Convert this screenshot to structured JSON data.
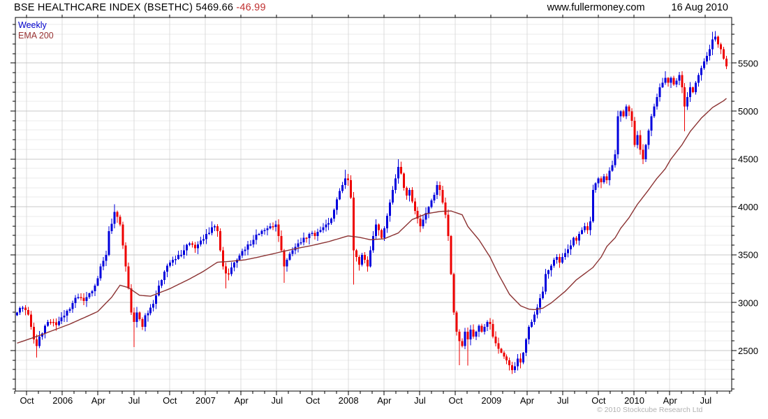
{
  "header": {
    "title_main": "BSE HEALTHCARE INDEX (BSETHC) 5469.66",
    "change": "-46.99",
    "site": "www.fullermoney.com",
    "date": "16 Aug 2010"
  },
  "legend": {
    "series1": "Weekly",
    "series2": "EMA 200"
  },
  "footer": {
    "copyright": "© 2010 Stockcube Research Ltd"
  },
  "colors": {
    "up_candle": "#0000dd",
    "down_candle": "#ee0000",
    "ema_line": "#8b3232",
    "grid_major": "#c8c8c8",
    "grid_minor": "#ebebeb",
    "grid_vertical": "#dcdcdc",
    "axis": "#000000",
    "label": "#000000"
  },
  "chart_data": {
    "type": "candlestick",
    "title": "BSE HEALTHCARE INDEX (BSETHC)",
    "last_close": 5469.66,
    "change": -46.99,
    "timeframe": "Weekly",
    "overlay": "EMA 200",
    "n_weeks": 256,
    "period_start": "Sep 2005",
    "period_end": "16 Aug 2010",
    "y_axis": {
      "range": [
        2080,
        5980
      ],
      "tick_minor": 100,
      "tick_major": 500,
      "labels": [
        2500,
        3000,
        3500,
        4000,
        4500,
        5000,
        5500
      ],
      "side": "right"
    },
    "x_axis": {
      "months_total": 60,
      "quarter_label_months": [
        1,
        4,
        7,
        10,
        13,
        16,
        19,
        22,
        25,
        28,
        31,
        34,
        37,
        40,
        43,
        46,
        49,
        52,
        55,
        58
      ],
      "labels": [
        "Oct",
        "2006",
        "Apr",
        "Jul",
        "Oct",
        "2007",
        "Apr",
        "Jul",
        "Oct",
        "2008",
        "Apr",
        "Jul",
        "Oct",
        "2009",
        "Apr",
        "Jul",
        "Oct",
        "2010",
        "Apr",
        "Jul"
      ]
    },
    "candles": {
      "first_open": 2870,
      "wiggle": [
        0,
        22,
        -18,
        12,
        -24
      ],
      "close_anchors": [
        [
          0,
          2900
        ],
        [
          2,
          2950
        ],
        [
          4,
          2880
        ],
        [
          6,
          2620
        ],
        [
          7,
          2550
        ],
        [
          8,
          2650
        ],
        [
          10,
          2760
        ],
        [
          12,
          2800
        ],
        [
          14,
          2770
        ],
        [
          16,
          2850
        ],
        [
          18,
          2920
        ],
        [
          20,
          3000
        ],
        [
          22,
          3060
        ],
        [
          24,
          3020
        ],
        [
          26,
          3100
        ],
        [
          28,
          3180
        ],
        [
          30,
          3380
        ],
        [
          31,
          3440
        ],
        [
          32,
          3500
        ],
        [
          33,
          3750
        ],
        [
          35,
          3950
        ],
        [
          36,
          3900
        ],
        [
          37,
          3820
        ],
        [
          38,
          3600
        ],
        [
          39,
          3380
        ],
        [
          40,
          3150
        ],
        [
          41,
          2900
        ],
        [
          42,
          2800
        ],
        [
          43,
          2900
        ],
        [
          44,
          2830
        ],
        [
          45,
          2750
        ],
        [
          46,
          2870
        ],
        [
          48,
          2950
        ],
        [
          50,
          3080
        ],
        [
          52,
          3240
        ],
        [
          54,
          3390
        ],
        [
          56,
          3450
        ],
        [
          58,
          3500
        ],
        [
          60,
          3550
        ],
        [
          62,
          3620
        ],
        [
          64,
          3570
        ],
        [
          66,
          3650
        ],
        [
          68,
          3720
        ],
        [
          70,
          3790
        ],
        [
          71,
          3800
        ],
        [
          72,
          3750
        ],
        [
          73,
          3550
        ],
        [
          74,
          3380
        ],
        [
          75,
          3310
        ],
        [
          76,
          3300
        ],
        [
          77,
          3370
        ],
        [
          79,
          3450
        ],
        [
          81,
          3540
        ],
        [
          83,
          3610
        ],
        [
          85,
          3660
        ],
        [
          87,
          3720
        ],
        [
          89,
          3760
        ],
        [
          91,
          3800
        ],
        [
          93,
          3820
        ],
        [
          94,
          3700
        ],
        [
          95,
          3550
        ],
        [
          96,
          3380
        ],
        [
          97,
          3450
        ],
        [
          99,
          3550
        ],
        [
          101,
          3620
        ],
        [
          103,
          3680
        ],
        [
          105,
          3720
        ],
        [
          107,
          3700
        ],
        [
          109,
          3760
        ],
        [
          111,
          3820
        ],
        [
          113,
          3880
        ],
        [
          114,
          3970
        ],
        [
          115,
          4080
        ],
        [
          116,
          4170
        ],
        [
          117,
          4230
        ],
        [
          118,
          4300
        ],
        [
          119,
          4280
        ],
        [
          120,
          4100
        ],
        [
          121,
          3550
        ],
        [
          122,
          3480
        ],
        [
          123,
          3400
        ],
        [
          124,
          3500
        ],
        [
          125,
          3450
        ],
        [
          126,
          3380
        ],
        [
          127,
          3550
        ],
        [
          128,
          3700
        ],
        [
          129,
          3820
        ],
        [
          130,
          3760
        ],
        [
          131,
          3680
        ],
        [
          132,
          3780
        ],
        [
          133,
          3910
        ],
        [
          134,
          4050
        ],
        [
          135,
          4180
        ],
        [
          136,
          4300
        ],
        [
          137,
          4420
        ],
        [
          138,
          4350
        ],
        [
          139,
          4200
        ],
        [
          140,
          4120
        ],
        [
          141,
          4180
        ],
        [
          142,
          4060
        ],
        [
          143,
          3960
        ],
        [
          144,
          3880
        ],
        [
          145,
          3800
        ],
        [
          146,
          3870
        ],
        [
          147,
          3940
        ],
        [
          148,
          4000
        ],
        [
          149,
          4070
        ],
        [
          150,
          4130
        ],
        [
          151,
          4230
        ],
        [
          152,
          4180
        ],
        [
          153,
          4050
        ],
        [
          154,
          3920
        ],
        [
          155,
          3700
        ],
        [
          156,
          3300
        ],
        [
          157,
          2900
        ],
        [
          158,
          2700
        ],
        [
          159,
          2600
        ],
        [
          160,
          2550
        ],
        [
          161,
          2700
        ],
        [
          162,
          2620
        ],
        [
          163,
          2720
        ],
        [
          164,
          2650
        ],
        [
          165,
          2700
        ],
        [
          166,
          2760
        ],
        [
          167,
          2700
        ],
        [
          168,
          2750
        ],
        [
          169,
          2800
        ],
        [
          170,
          2780
        ],
        [
          171,
          2650
        ],
        [
          172,
          2580
        ],
        [
          173,
          2520
        ],
        [
          174,
          2480
        ],
        [
          175,
          2440
        ],
        [
          176,
          2400
        ],
        [
          177,
          2350
        ],
        [
          178,
          2300
        ],
        [
          179,
          2340
        ],
        [
          180,
          2420
        ],
        [
          181,
          2380
        ],
        [
          182,
          2480
        ],
        [
          183,
          2620
        ],
        [
          184,
          2750
        ],
        [
          185,
          2800
        ],
        [
          186,
          2880
        ],
        [
          187,
          2950
        ],
        [
          188,
          3050
        ],
        [
          189,
          3120
        ],
        [
          190,
          3300
        ],
        [
          191,
          3340
        ],
        [
          192,
          3390
        ],
        [
          193,
          3450
        ],
        [
          194,
          3480
        ],
        [
          195,
          3420
        ],
        [
          196,
          3480
        ],
        [
          197,
          3520
        ],
        [
          198,
          3560
        ],
        [
          199,
          3600
        ],
        [
          200,
          3680
        ],
        [
          201,
          3650
        ],
        [
          202,
          3720
        ],
        [
          203,
          3760
        ],
        [
          204,
          3800
        ],
        [
          205,
          3760
        ],
        [
          206,
          3850
        ],
        [
          207,
          4180
        ],
        [
          208,
          4250
        ],
        [
          209,
          4300
        ],
        [
          210,
          4260
        ],
        [
          211,
          4320
        ],
        [
          212,
          4280
        ],
        [
          213,
          4380
        ],
        [
          214,
          4440
        ],
        [
          215,
          4550
        ],
        [
          216,
          4950
        ],
        [
          217,
          5000
        ],
        [
          218,
          4950
        ],
        [
          219,
          5050
        ],
        [
          220,
          5000
        ],
        [
          221,
          4900
        ],
        [
          222,
          4650
        ],
        [
          223,
          4750
        ],
        [
          224,
          4600
        ],
        [
          225,
          4500
        ],
        [
          226,
          4650
        ],
        [
          227,
          4800
        ],
        [
          228,
          4950
        ],
        [
          229,
          5050
        ],
        [
          230,
          5150
        ],
        [
          231,
          5250
        ],
        [
          232,
          5300
        ],
        [
          233,
          5350
        ],
        [
          234,
          5300
        ],
        [
          235,
          5350
        ],
        [
          236,
          5280
        ],
        [
          237,
          5320
        ],
        [
          238,
          5380
        ],
        [
          239,
          5250
        ],
        [
          240,
          5050
        ],
        [
          241,
          5150
        ],
        [
          242,
          5250
        ],
        [
          243,
          5200
        ],
        [
          244,
          5300
        ],
        [
          245,
          5380
        ],
        [
          246,
          5450
        ],
        [
          247,
          5520
        ],
        [
          248,
          5580
        ],
        [
          249,
          5650
        ],
        [
          250,
          5750
        ],
        [
          251,
          5780
        ],
        [
          252,
          5700
        ],
        [
          253,
          5650
        ],
        [
          254,
          5550
        ],
        [
          255,
          5469.66
        ]
      ],
      "wick_overrides": {
        "7": {
          "low": 2430
        },
        "35": {
          "high": 4030
        },
        "42": {
          "low": 2540
        },
        "70": {
          "high": 3850
        },
        "75": {
          "low": 3150
        },
        "93": {
          "high": 3860
        },
        "96": {
          "low": 3210
        },
        "118": {
          "high": 4390
        },
        "121": {
          "low": 3190
        },
        "137": {
          "high": 4500
        },
        "145": {
          "low": 3740
        },
        "151": {
          "high": 4270
        },
        "159": {
          "low": 2350
        },
        "162": {
          "low": 2345
        },
        "169": {
          "high": 2820
        },
        "178": {
          "low": 2260
        },
        "195": {
          "low": 3365
        },
        "220": {
          "high": 5070
        },
        "225": {
          "low": 4450
        },
        "233": {
          "high": 5420
        },
        "240": {
          "low": 4790
        },
        "250": {
          "high": 5830
        }
      }
    },
    "ema_anchors": [
      [
        0,
        2580
      ],
      [
        9,
        2670
      ],
      [
        19,
        2780
      ],
      [
        29,
        2910
      ],
      [
        34,
        3060
      ],
      [
        37,
        3185
      ],
      [
        40,
        3160
      ],
      [
        44,
        3080
      ],
      [
        48,
        3070
      ],
      [
        55,
        3150
      ],
      [
        62,
        3250
      ],
      [
        67,
        3330
      ],
      [
        72,
        3425
      ],
      [
        77,
        3435
      ],
      [
        82,
        3450
      ],
      [
        87,
        3480
      ],
      [
        93,
        3520
      ],
      [
        99,
        3560
      ],
      [
        106,
        3600
      ],
      [
        112,
        3640
      ],
      [
        119,
        3700
      ],
      [
        123,
        3685
      ],
      [
        127,
        3660
      ],
      [
        132,
        3670
      ],
      [
        137,
        3730
      ],
      [
        142,
        3870
      ],
      [
        147,
        3930
      ],
      [
        152,
        3955
      ],
      [
        156,
        3960
      ],
      [
        160,
        3920
      ],
      [
        162,
        3800
      ],
      [
        166,
        3660
      ],
      [
        170,
        3480
      ],
      [
        173,
        3300
      ],
      [
        177,
        3090
      ],
      [
        181,
        2970
      ],
      [
        184,
        2935
      ],
      [
        186,
        2930
      ],
      [
        189,
        2945
      ],
      [
        192,
        3000
      ],
      [
        197,
        3120
      ],
      [
        201,
        3240
      ],
      [
        207,
        3370
      ],
      [
        210,
        3480
      ],
      [
        212,
        3590
      ],
      [
        215,
        3680
      ],
      [
        217,
        3780
      ],
      [
        220,
        3890
      ],
      [
        223,
        4030
      ],
      [
        227,
        4180
      ],
      [
        230,
        4300
      ],
      [
        233,
        4400
      ],
      [
        235,
        4500
      ],
      [
        239,
        4650
      ],
      [
        242,
        4790
      ],
      [
        246,
        4930
      ],
      [
        250,
        5040
      ],
      [
        254,
        5110
      ],
      [
        255,
        5135
      ]
    ]
  }
}
